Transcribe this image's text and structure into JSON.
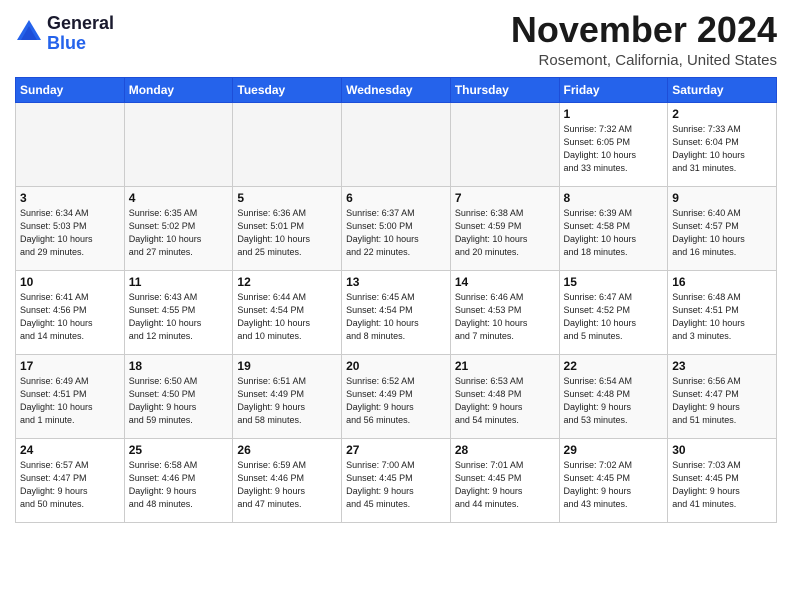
{
  "logo": {
    "line1": "General",
    "line2": "Blue"
  },
  "header": {
    "month": "November 2024",
    "location": "Rosemont, California, United States"
  },
  "days_of_week": [
    "Sunday",
    "Monday",
    "Tuesday",
    "Wednesday",
    "Thursday",
    "Friday",
    "Saturday"
  ],
  "weeks": [
    [
      {
        "day": "",
        "info": ""
      },
      {
        "day": "",
        "info": ""
      },
      {
        "day": "",
        "info": ""
      },
      {
        "day": "",
        "info": ""
      },
      {
        "day": "",
        "info": ""
      },
      {
        "day": "1",
        "info": "Sunrise: 7:32 AM\nSunset: 6:05 PM\nDaylight: 10 hours\nand 33 minutes."
      },
      {
        "day": "2",
        "info": "Sunrise: 7:33 AM\nSunset: 6:04 PM\nDaylight: 10 hours\nand 31 minutes."
      }
    ],
    [
      {
        "day": "3",
        "info": "Sunrise: 6:34 AM\nSunset: 5:03 PM\nDaylight: 10 hours\nand 29 minutes."
      },
      {
        "day": "4",
        "info": "Sunrise: 6:35 AM\nSunset: 5:02 PM\nDaylight: 10 hours\nand 27 minutes."
      },
      {
        "day": "5",
        "info": "Sunrise: 6:36 AM\nSunset: 5:01 PM\nDaylight: 10 hours\nand 25 minutes."
      },
      {
        "day": "6",
        "info": "Sunrise: 6:37 AM\nSunset: 5:00 PM\nDaylight: 10 hours\nand 22 minutes."
      },
      {
        "day": "7",
        "info": "Sunrise: 6:38 AM\nSunset: 4:59 PM\nDaylight: 10 hours\nand 20 minutes."
      },
      {
        "day": "8",
        "info": "Sunrise: 6:39 AM\nSunset: 4:58 PM\nDaylight: 10 hours\nand 18 minutes."
      },
      {
        "day": "9",
        "info": "Sunrise: 6:40 AM\nSunset: 4:57 PM\nDaylight: 10 hours\nand 16 minutes."
      }
    ],
    [
      {
        "day": "10",
        "info": "Sunrise: 6:41 AM\nSunset: 4:56 PM\nDaylight: 10 hours\nand 14 minutes."
      },
      {
        "day": "11",
        "info": "Sunrise: 6:43 AM\nSunset: 4:55 PM\nDaylight: 10 hours\nand 12 minutes."
      },
      {
        "day": "12",
        "info": "Sunrise: 6:44 AM\nSunset: 4:54 PM\nDaylight: 10 hours\nand 10 minutes."
      },
      {
        "day": "13",
        "info": "Sunrise: 6:45 AM\nSunset: 4:54 PM\nDaylight: 10 hours\nand 8 minutes."
      },
      {
        "day": "14",
        "info": "Sunrise: 6:46 AM\nSunset: 4:53 PM\nDaylight: 10 hours\nand 7 minutes."
      },
      {
        "day": "15",
        "info": "Sunrise: 6:47 AM\nSunset: 4:52 PM\nDaylight: 10 hours\nand 5 minutes."
      },
      {
        "day": "16",
        "info": "Sunrise: 6:48 AM\nSunset: 4:51 PM\nDaylight: 10 hours\nand 3 minutes."
      }
    ],
    [
      {
        "day": "17",
        "info": "Sunrise: 6:49 AM\nSunset: 4:51 PM\nDaylight: 10 hours\nand 1 minute."
      },
      {
        "day": "18",
        "info": "Sunrise: 6:50 AM\nSunset: 4:50 PM\nDaylight: 9 hours\nand 59 minutes."
      },
      {
        "day": "19",
        "info": "Sunrise: 6:51 AM\nSunset: 4:49 PM\nDaylight: 9 hours\nand 58 minutes."
      },
      {
        "day": "20",
        "info": "Sunrise: 6:52 AM\nSunset: 4:49 PM\nDaylight: 9 hours\nand 56 minutes."
      },
      {
        "day": "21",
        "info": "Sunrise: 6:53 AM\nSunset: 4:48 PM\nDaylight: 9 hours\nand 54 minutes."
      },
      {
        "day": "22",
        "info": "Sunrise: 6:54 AM\nSunset: 4:48 PM\nDaylight: 9 hours\nand 53 minutes."
      },
      {
        "day": "23",
        "info": "Sunrise: 6:56 AM\nSunset: 4:47 PM\nDaylight: 9 hours\nand 51 minutes."
      }
    ],
    [
      {
        "day": "24",
        "info": "Sunrise: 6:57 AM\nSunset: 4:47 PM\nDaylight: 9 hours\nand 50 minutes."
      },
      {
        "day": "25",
        "info": "Sunrise: 6:58 AM\nSunset: 4:46 PM\nDaylight: 9 hours\nand 48 minutes."
      },
      {
        "day": "26",
        "info": "Sunrise: 6:59 AM\nSunset: 4:46 PM\nDaylight: 9 hours\nand 47 minutes."
      },
      {
        "day": "27",
        "info": "Sunrise: 7:00 AM\nSunset: 4:45 PM\nDaylight: 9 hours\nand 45 minutes."
      },
      {
        "day": "28",
        "info": "Sunrise: 7:01 AM\nSunset: 4:45 PM\nDaylight: 9 hours\nand 44 minutes."
      },
      {
        "day": "29",
        "info": "Sunrise: 7:02 AM\nSunset: 4:45 PM\nDaylight: 9 hours\nand 43 minutes."
      },
      {
        "day": "30",
        "info": "Sunrise: 7:03 AM\nSunset: 4:45 PM\nDaylight: 9 hours\nand 41 minutes."
      }
    ]
  ]
}
